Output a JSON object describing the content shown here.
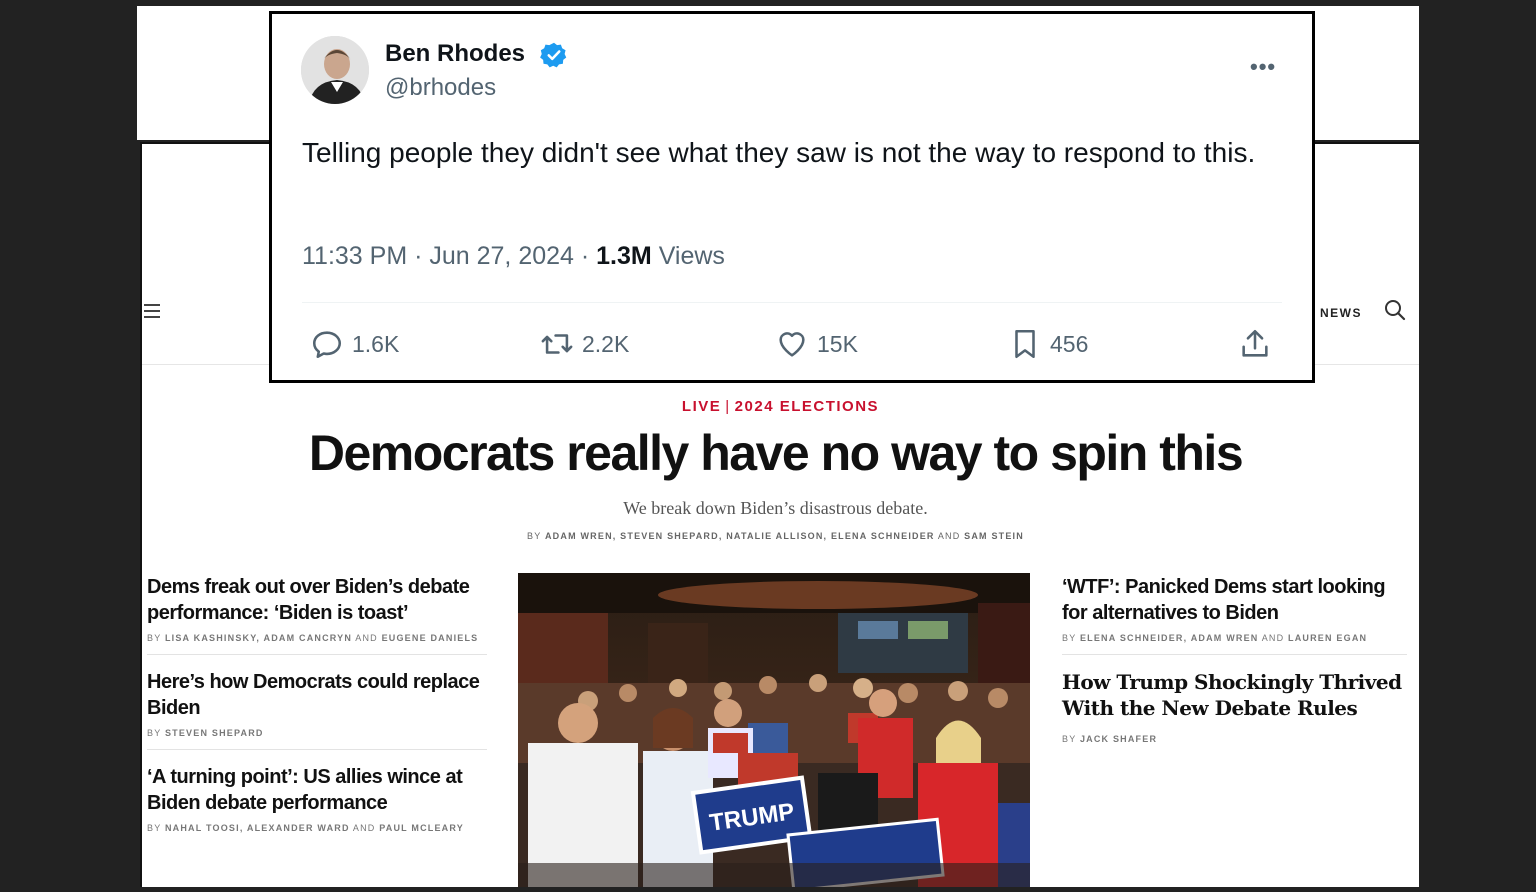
{
  "tweet": {
    "name": "Ben Rhodes",
    "handle": "@brhodes",
    "more": "•••",
    "text": "Telling people they didn't see what they saw is not the way to respond to this.",
    "time": "11:33 PM · Jun 27, 2024 · ",
    "views_count": "1.3M",
    "views_label": " Views",
    "replies": "1.6K",
    "reposts": "2.2K",
    "likes": "15K",
    "bookmarks": "456",
    "icons": [
      "verified-icon",
      "reply-icon",
      "repost-icon",
      "like-icon",
      "bookmark-icon",
      "share-icon",
      "more-icon"
    ],
    "colors": {
      "verified": "#1d9bf0",
      "text": "#0f1419",
      "muted": "#536471"
    }
  },
  "article": {
    "nav_news": "NEWS",
    "kicker_live": "LIVE",
    "kicker_sep": "|",
    "kicker_section": "2024 ELECTIONS",
    "headline": "Democrats really have no way to spin this",
    "dek": "We break down Biden’s disastrous debate.",
    "byline": {
      "by": "BY ",
      "names": "ADAM WREN, STEVEN SHEPARD, NATALIE ALLISON, ELENA SCHNEIDER",
      "and": " AND ",
      "last": "SAM STEIN"
    },
    "accent_color": "#c8102e",
    "left_stories": [
      {
        "title": "Dems freak out over Biden’s debate performance: ‘Biden is toast’",
        "by": "BY ",
        "authors": "LISA KASHINSKY, ADAM CANCRYN",
        "and": " AND ",
        "last": "EUGENE DANIELS"
      },
      {
        "title": "Here’s how Democrats could replace Biden",
        "by": "BY ",
        "authors": "STEVEN SHEPARD",
        "and": "",
        "last": ""
      },
      {
        "title": "‘A turning point’: US allies wince at Biden debate performance",
        "by": "BY ",
        "authors": "NAHAL TOOSI, ALEXANDER WARD",
        "and": " AND ",
        "last": "PAUL MCLEARY"
      }
    ],
    "right_stories": [
      {
        "title": "‘WTF’: Panicked Dems start looking for alternatives to Biden",
        "by": "BY ",
        "authors": "ELENA SCHNEIDER, ADAM WREN",
        "and": " AND ",
        "last": "LAUREN EGAN"
      },
      {
        "title": "How Trump Shockingly Thrived With the New Debate Rules",
        "by": "BY ",
        "authors": "JACK SHAFER",
        "and": "",
        "last": ""
      }
    ],
    "photo_sign": "TRUMP"
  }
}
